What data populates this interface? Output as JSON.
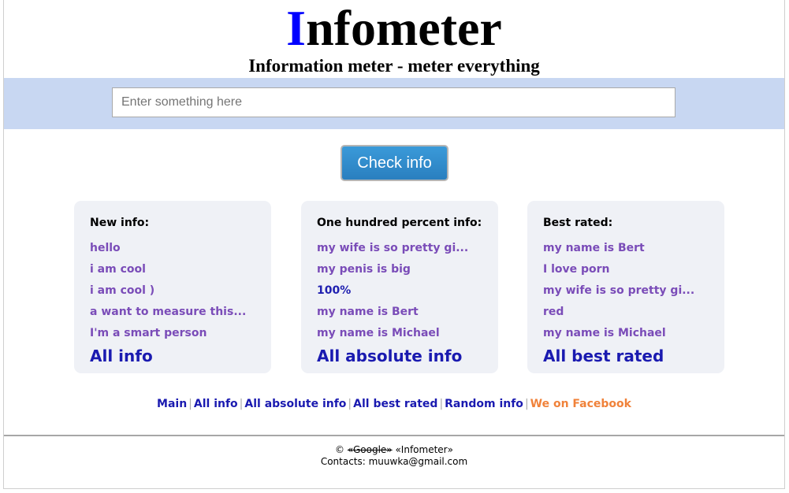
{
  "header": {
    "logo_first_letter": "I",
    "logo_rest": "nfometer",
    "tagline": "Information meter - meter everything"
  },
  "search": {
    "placeholder": "Enter something here",
    "value": "",
    "button_label": "Check info"
  },
  "colors": {
    "logo_accent": "#0000ff",
    "search_band": "#c8d7f2",
    "button": "#3a9ad9",
    "link": "#7a4cb8",
    "link_strong": "#1a1ab0",
    "facebook": "#f0823a"
  },
  "cards": [
    {
      "title": "New info:",
      "items": [
        "hello",
        "i am cool",
        "i am cool )",
        "a want to measure this...",
        "I'm a smart person"
      ],
      "all_label": "All info"
    },
    {
      "title": "One hundred percent info:",
      "items": [
        "my wife is so pretty gi...",
        "my penis is big",
        "100%",
        "my name is Bert",
        "my name is Michael"
      ],
      "all_label": "All absolute info"
    },
    {
      "title": "Best rated:",
      "items": [
        "my name is Bert",
        "I love porn",
        "my wife is so pretty gi...",
        "red",
        "my name is Michael"
      ],
      "all_label": "All best rated"
    }
  ],
  "footer_nav": {
    "links": [
      "Main",
      "All info",
      "All absolute info",
      "All best rated",
      "Random info"
    ],
    "separator": "|",
    "facebook_label": "We on Facebook"
  },
  "footer": {
    "copyright_symbol": "©",
    "struck_text": "«Google»",
    "brand_text": "«Infometer»",
    "contacts": "Contacts: muuwka@gmail.com"
  }
}
